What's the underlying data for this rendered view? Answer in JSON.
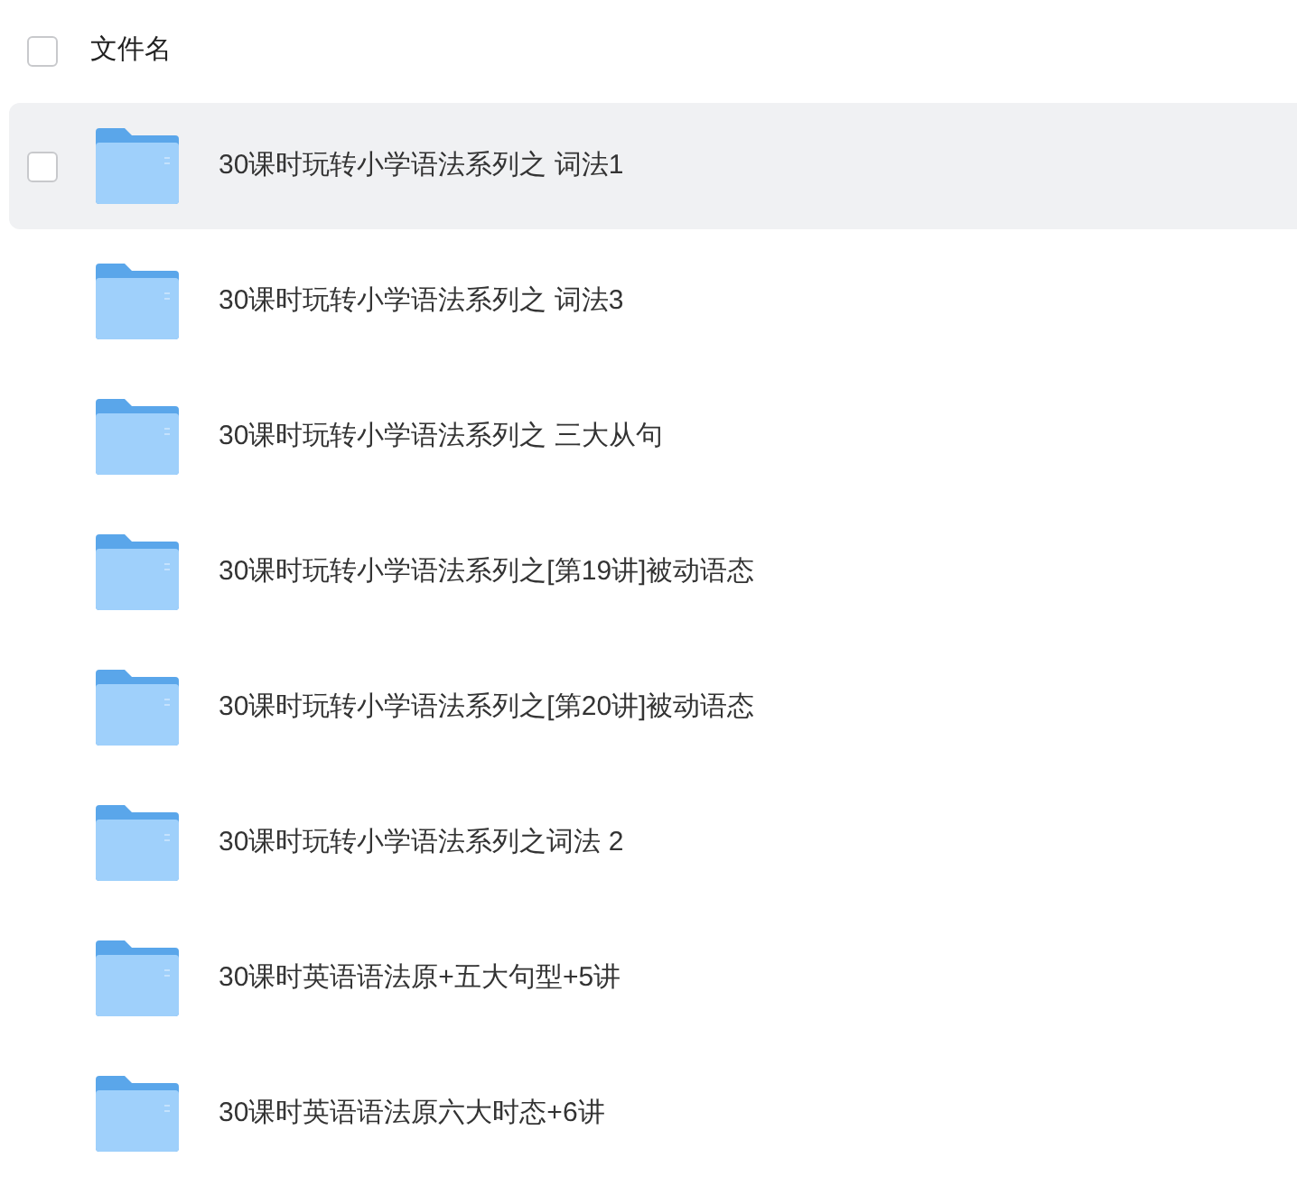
{
  "header": {
    "checked": false,
    "label": "文件名"
  },
  "rows": [
    {
      "name": "30课时玩转小学语法系列之 词法1",
      "hovered": true,
      "checked": false
    },
    {
      "name": "30课时玩转小学语法系列之 词法3",
      "hovered": false,
      "checked": false
    },
    {
      "name": "30课时玩转小学语法系列之 三大从句",
      "hovered": false,
      "checked": false
    },
    {
      "name": "30课时玩转小学语法系列之[第19讲]被动语态",
      "hovered": false,
      "checked": false
    },
    {
      "name": "30课时玩转小学语法系列之[第20讲]被动语态",
      "hovered": false,
      "checked": false
    },
    {
      "name": "30课时玩转小学语法系列之词法 2",
      "hovered": false,
      "checked": false
    },
    {
      "name": "30课时英语语法原+五大句型+5讲",
      "hovered": false,
      "checked": false
    },
    {
      "name": "30课时英语语法原六大时态+6讲",
      "hovered": false,
      "checked": false
    }
  ]
}
